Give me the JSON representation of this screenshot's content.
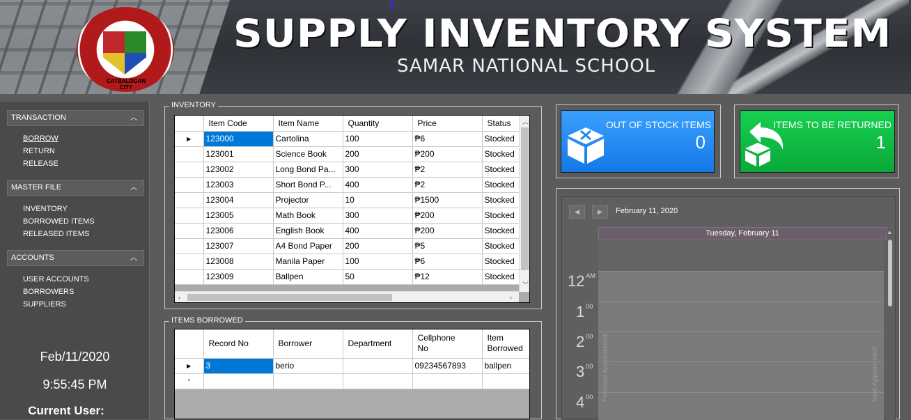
{
  "header": {
    "title": "SUPPLY INVENTORY SYSTEM",
    "subtitle": "SAMAR NATIONAL SCHOOL",
    "seal_text": "CATBALOGAN CITY"
  },
  "sidebar": {
    "sections": [
      {
        "label": "TRANSACTION",
        "items": [
          "BORROW",
          "RETURN",
          "RELEASE"
        ]
      },
      {
        "label": "MASTER FILE",
        "items": [
          "INVENTORY",
          "BORROWED ITEMS",
          "RELEASED ITEMS"
        ]
      },
      {
        "label": "ACCOUNTS",
        "items": [
          "USER ACCOUNTS",
          "BORROWERS",
          "SUPPLIERS"
        ]
      }
    ],
    "date": "Feb/11/2020",
    "time": "9:55:45 PM",
    "current_user_label": "Current User:"
  },
  "inventory": {
    "group_title": "INVENTORY",
    "columns": [
      "Item Code",
      "Item Name",
      "Quantity",
      "Price",
      "Status"
    ],
    "rows": [
      [
        "123000",
        "Cartolina",
        "100",
        "₱6",
        "Stocked"
      ],
      [
        "123001",
        "Science Book",
        "200",
        "₱200",
        "Stocked"
      ],
      [
        "123002",
        "Long Bond Pa...",
        "300",
        "₱2",
        "Stocked"
      ],
      [
        "123003",
        "Short Bond P...",
        "400",
        "₱2",
        "Stocked"
      ],
      [
        "123004",
        "Projector",
        "10",
        "₱1500",
        "Stocked"
      ],
      [
        "123005",
        "Math Book",
        "300",
        "₱200",
        "Stocked"
      ],
      [
        "123006",
        "English Book",
        "400",
        "₱200",
        "Stocked"
      ],
      [
        "123007",
        "A4 Bond Paper",
        "200",
        "₱5",
        "Stocked"
      ],
      [
        "123008",
        "Manila Paper",
        "100",
        "₱6",
        "Stocked"
      ],
      [
        "123009",
        "Ballpen",
        "50",
        "₱12",
        "Stocked"
      ]
    ]
  },
  "borrowed": {
    "group_title": "ITEMS BORROWED",
    "columns": [
      "Record No",
      "Borrower",
      "Department",
      "Cellphone\nNo",
      "Item\nBorrowed"
    ],
    "rows": [
      [
        "3",
        "berio",
        "",
        "09234567893",
        "ballpen"
      ]
    ]
  },
  "tiles": {
    "out_of_stock": {
      "label": "OUT OF STOCK ITEMS",
      "count": "0",
      "color": "#1e90ff"
    },
    "to_return": {
      "label": "ITEMS TO BE RETURNED",
      "count": "1",
      "color": "#10c040"
    }
  },
  "calendar": {
    "date_label": "February 11, 2020",
    "day_header": "Tuesday, February 11",
    "hours": [
      {
        "h": "12",
        "suffix": "AM"
      },
      {
        "h": "1",
        "suffix": "00"
      },
      {
        "h": "2",
        "suffix": "00"
      },
      {
        "h": "3",
        "suffix": "00"
      },
      {
        "h": "4",
        "suffix": "00"
      }
    ],
    "prev_label": "Previous Appointment",
    "next_label": "Next Appointment"
  }
}
